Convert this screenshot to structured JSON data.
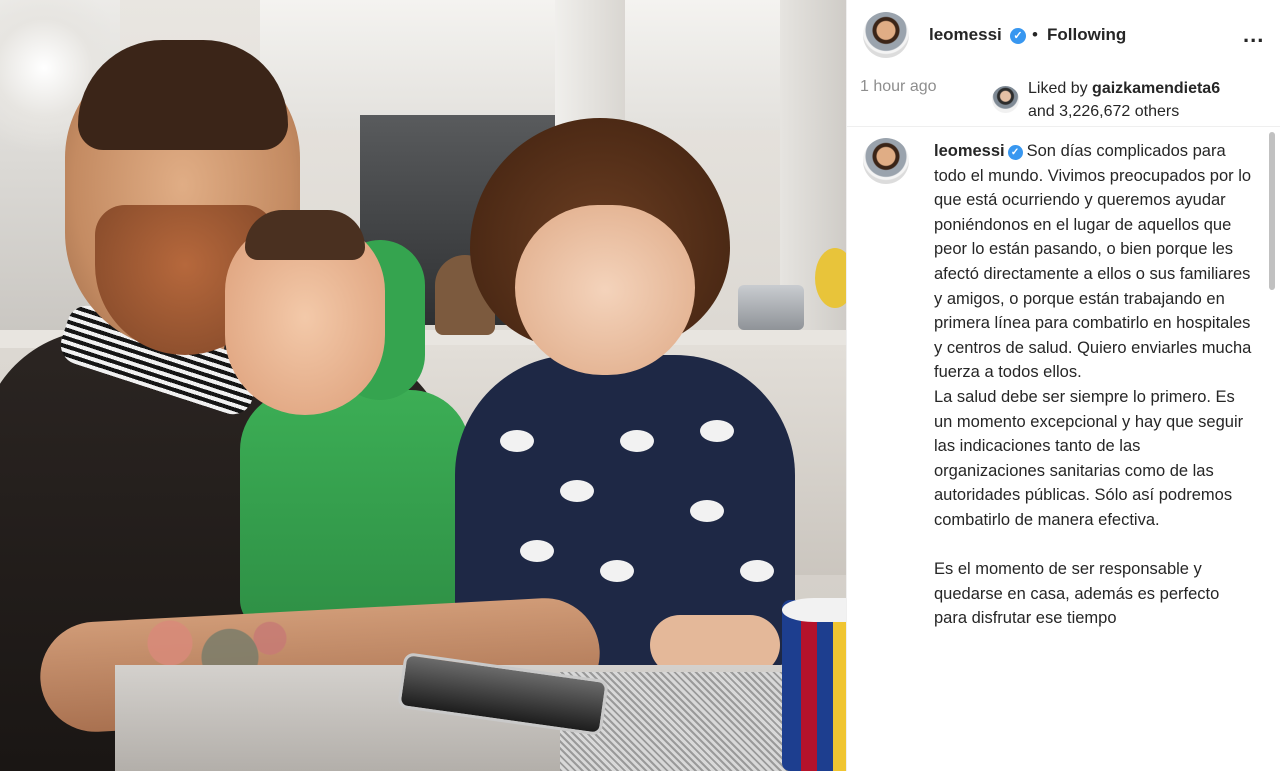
{
  "post": {
    "username": "leomessi",
    "separator": "•",
    "follow_status": "Following",
    "more_label": "...",
    "time": "1 hour ago",
    "liked_prefix": "Liked by",
    "liked_user": "gaizkamendieta6",
    "liked_suffix": "and 3,226,672 others",
    "caption_user": "leomessi",
    "caption_text": "Son días complicados para todo el mundo. Vivimos preocupados por lo que está ocurriendo y queremos ayudar poniéndonos en el lugar de aquellos que peor lo están pasando, o bien porque les afectó directamente a ellos o sus familiares y amigos, o porque están trabajando en primera línea para combatirlo en hospitales y centros de salud. Quiero enviarles mucha fuerza a todos ellos.\nLa salud debe ser siempre lo primero. Es un momento excepcional y hay que seguir las indicaciones tanto de las organizaciones sanitarias como de las autoridades públicas. Sólo así podremos combatirlo de manera efectiva.\n\nEs el momento de ser responsable y quedarse en casa, además es perfecto para disfrutar ese tiempo"
  },
  "colors": {
    "verified": "#3897f0",
    "text": "#262626",
    "muted": "#8e8e8e"
  },
  "icons": {
    "verified": "verified-badge-icon",
    "more": "more-options-icon"
  }
}
